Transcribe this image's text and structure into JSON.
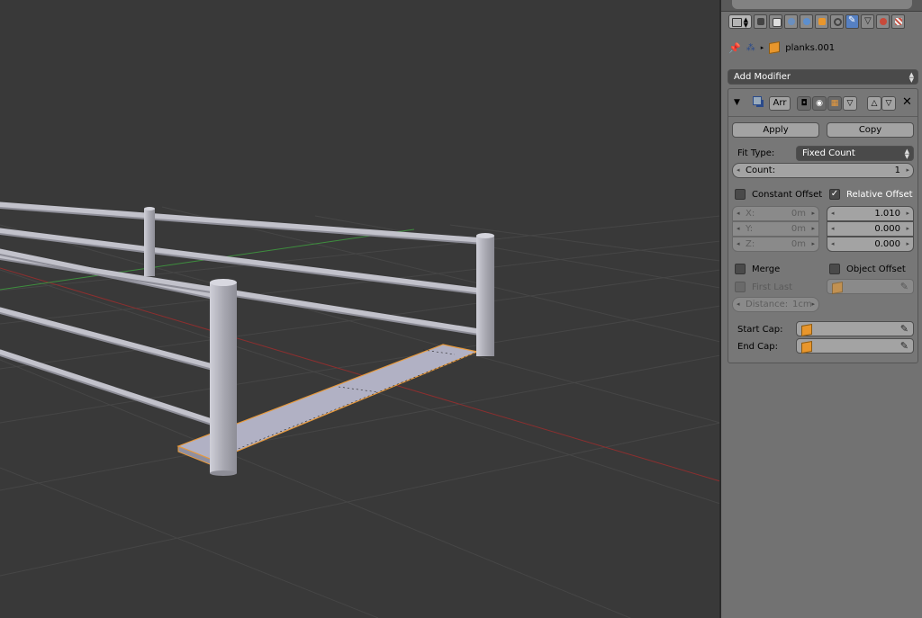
{
  "colors": {
    "viewport_bg": "#393939",
    "panel_bg": "#727272",
    "active_tab": "#5680c2",
    "x_axis": "#8c2f2f",
    "y_axis": "#3e8e3e",
    "selection": "#e89a3c",
    "rail": "#b4b4bc"
  },
  "header": {
    "tabs": [
      {
        "name": "render-tab",
        "icon": "camera-icon"
      },
      {
        "name": "render-layers-tab",
        "icon": "layers-icon"
      },
      {
        "name": "scene-tab",
        "icon": "scene-icon"
      },
      {
        "name": "world-tab",
        "icon": "world-icon"
      },
      {
        "name": "object-tab",
        "icon": "object-icon"
      },
      {
        "name": "constraints-tab",
        "icon": "link-icon"
      },
      {
        "name": "modifiers-tab",
        "icon": "wrench-icon",
        "active": true
      },
      {
        "name": "data-tab",
        "icon": "mesh-data-icon"
      },
      {
        "name": "material-tab",
        "icon": "material-icon"
      },
      {
        "name": "texture-tab",
        "icon": "texture-icon"
      }
    ],
    "object_name": "planks.001"
  },
  "add_modifier": "Add Modifier",
  "modifier": {
    "name": "Arr",
    "apply_label": "Apply",
    "copy_label": "Copy",
    "fit_type_label": "Fit Type:",
    "fit_type_value": "Fixed Count",
    "count_label": "Count:",
    "count_value": "1",
    "constant_offset_label": "Constant Offset",
    "constant_offset_checked": false,
    "relative_offset_label": "Relative Offset",
    "relative_offset_checked": true,
    "constant": {
      "x_label": "X:",
      "x_value": "0m",
      "y_label": "Y:",
      "y_value": "0m",
      "z_label": "Z:",
      "z_value": "0m"
    },
    "relative": {
      "x_value": "1.010",
      "y_value": "0.000",
      "z_value": "0.000"
    },
    "merge_label": "Merge",
    "merge_checked": false,
    "object_offset_label": "Object Offset",
    "object_offset_checked": false,
    "first_last_label": "First Last",
    "distance_label": "Distance:",
    "distance_value": "1cm",
    "start_cap_label": "Start Cap:",
    "end_cap_label": "End Cap:"
  }
}
